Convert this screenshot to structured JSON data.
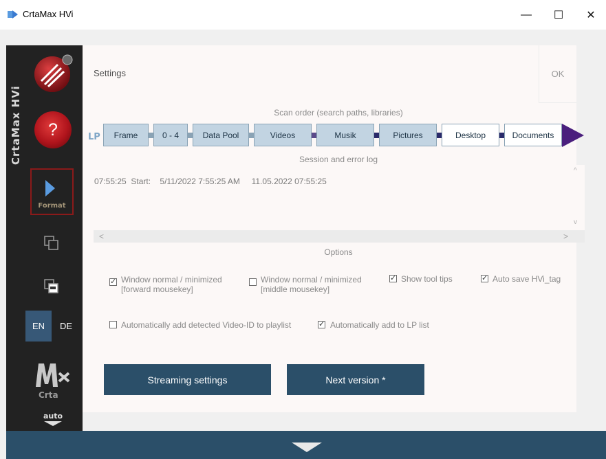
{
  "window": {
    "title": "CrtaMax HVi",
    "controls": {
      "minimize": "—",
      "maximize": "☐",
      "close": "✕"
    }
  },
  "sidebar": {
    "brand_text": "CrtaMax HVi",
    "help_label": "?",
    "format_label": "Format",
    "languages": [
      {
        "label": "EN",
        "active": true
      },
      {
        "label": "DE",
        "active": false
      }
    ],
    "logo_text": "Crta",
    "auto_label": "auto",
    "icons": [
      "disk-icon",
      "help-icon",
      "play-icon",
      "copy-icon",
      "copy-top-icon",
      "mx-logo-icon",
      "auto-down-icon"
    ]
  },
  "header": {
    "settings_label": "Settings",
    "ok_label": "OK"
  },
  "scan_order": {
    "label": "Scan order (search paths, libraries)",
    "items": [
      {
        "label": "Frame",
        "style": "blue"
      },
      {
        "label": "0 - 4",
        "style": "blue"
      },
      {
        "label": "Data Pool",
        "style": "blue"
      },
      {
        "label": "Videos",
        "style": "blue"
      },
      {
        "label": "Musik",
        "style": "blue"
      },
      {
        "label": "Pictures",
        "style": "blue"
      },
      {
        "label": "Desktop",
        "style": "white"
      },
      {
        "label": "Documents",
        "style": "white"
      }
    ]
  },
  "log": {
    "label": "Session and error log",
    "lines": [
      "07:55:25  Start:    5/11/2022 7:55:25 AM     11.05.2022 07:55:25"
    ]
  },
  "options": {
    "label": "Options",
    "window_normal_forward": {
      "line1": "Window normal / minimized",
      "line2": "[forward mousekey]",
      "checked": true
    },
    "window_normal_middle": {
      "line1": "Window normal / minimized",
      "line2": "[middle mousekey]",
      "checked": false
    },
    "show_tool_tips": {
      "label": "Show tool tips",
      "checked": true
    },
    "auto_save_tag": {
      "label": "Auto save HVi_tag",
      "checked": true
    },
    "auto_add_video_id": {
      "label": "Automatically add detected Video-ID to playlist",
      "checked": false
    },
    "auto_add_lp": {
      "label": "Automatically add to LP list",
      "checked": true
    }
  },
  "buttons": {
    "streaming_settings": "Streaming settings",
    "next_version": "Next version  *"
  },
  "colors": {
    "accent": "#2b4f69",
    "sidebar": "#222222",
    "chip_blue": "#c2d4e2",
    "arrow": "#4a1f7d",
    "help_red": "#b0141c"
  }
}
